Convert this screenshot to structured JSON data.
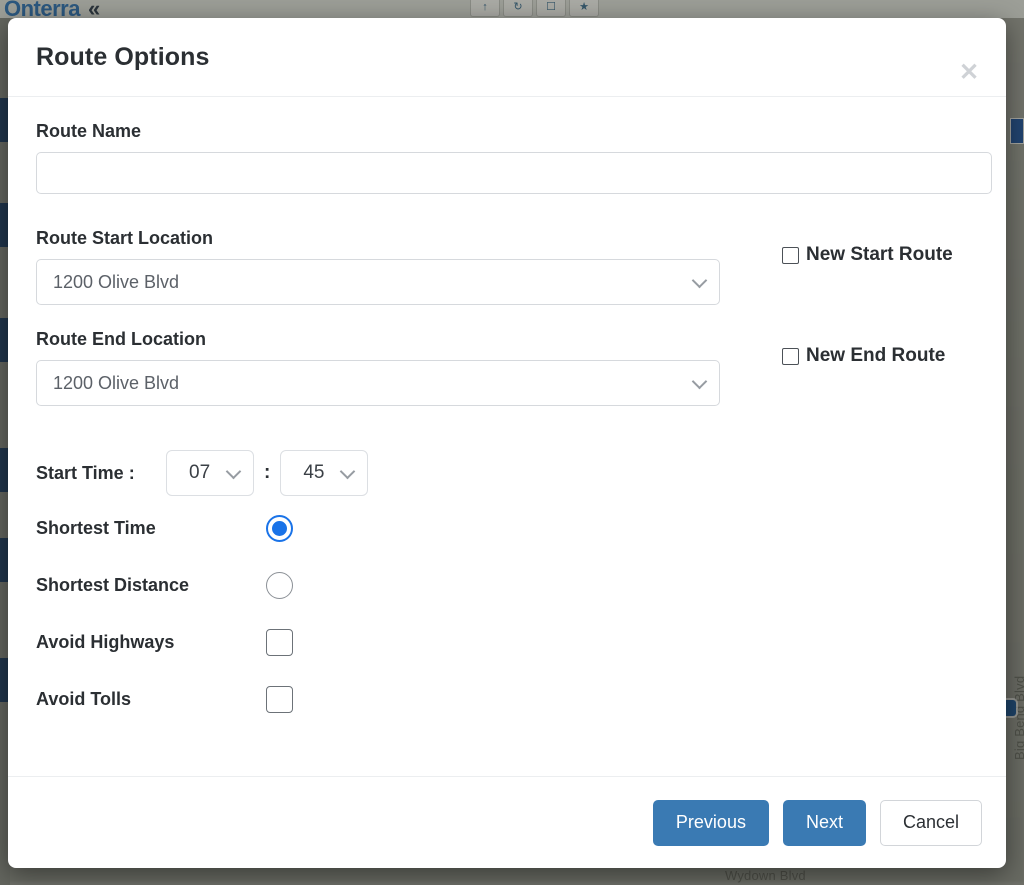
{
  "background": {
    "brand": "Onterra",
    "collapse_icon": "double-chevron-left-icon",
    "toolbar_icons": [
      "pointer-icon",
      "refresh-icon",
      "message-icon",
      "bookmark-icon"
    ],
    "map_labels": [
      {
        "text": "Big Bend Blvd",
        "orientation": "vertical"
      },
      {
        "text": "Wydown Blvd",
        "orientation": "horizontal"
      }
    ]
  },
  "modal": {
    "title": "Route Options",
    "close_icon": "close-icon",
    "route_name": {
      "label": "Route Name",
      "value": "",
      "placeholder": ""
    },
    "route_start": {
      "label": "Route Start Location",
      "selected": "1200 Olive Blvd",
      "chevron_icon": "chevron-down-icon",
      "checkbox": {
        "label": "New Start Route",
        "checked": false
      }
    },
    "route_end": {
      "label": "Route End Location",
      "selected": "1200 Olive Blvd",
      "chevron_icon": "chevron-down-icon",
      "checkbox": {
        "label": "New End Route",
        "checked": false
      }
    },
    "start_time": {
      "label": "Start Time :",
      "hour": "07",
      "separator": ":",
      "minute": "45",
      "chevron_icon": "chevron-down-icon"
    },
    "options": [
      {
        "label": "Shortest Time",
        "control": "radio",
        "checked": true
      },
      {
        "label": "Shortest Distance",
        "control": "radio",
        "checked": false
      },
      {
        "label": "Avoid Highways",
        "control": "checkbox",
        "checked": false
      },
      {
        "label": "Avoid Tolls",
        "control": "checkbox",
        "checked": false
      }
    ],
    "footer": {
      "previous_label": "Previous",
      "next_label": "Next",
      "cancel_label": "Cancel"
    }
  },
  "colors": {
    "primary_button": "#3a7ab3",
    "radio_selected": "#1a73e8",
    "brand": "#2f6ea5",
    "text": "#2b2f33"
  }
}
